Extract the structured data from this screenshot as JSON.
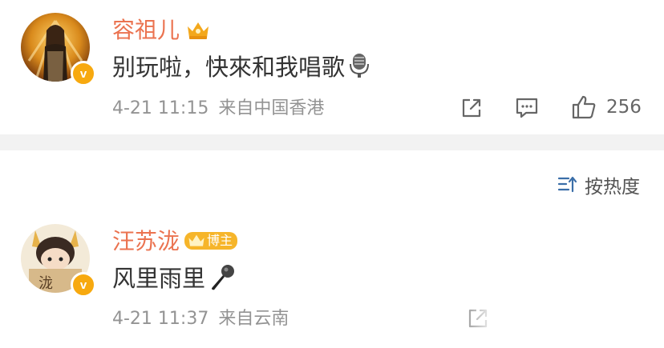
{
  "comments": [
    {
      "username": "容祖儿",
      "text": "别玩啦，快來和我唱歌",
      "emoji_icon": "microphone-icon",
      "date": "4-21 11:15",
      "source": "来自中国香港",
      "likes": "256"
    },
    {
      "username": "汪苏泷",
      "badge": "博主",
      "text": "风里雨里",
      "emoji_icon": "microphone-icon",
      "date": "4-21 11:37",
      "source": "来自云南"
    }
  ],
  "sort_label": "按热度",
  "colors": {
    "username": "#eb7350",
    "badge": "#f7a90f",
    "text": "#333333",
    "meta": "#939393"
  }
}
